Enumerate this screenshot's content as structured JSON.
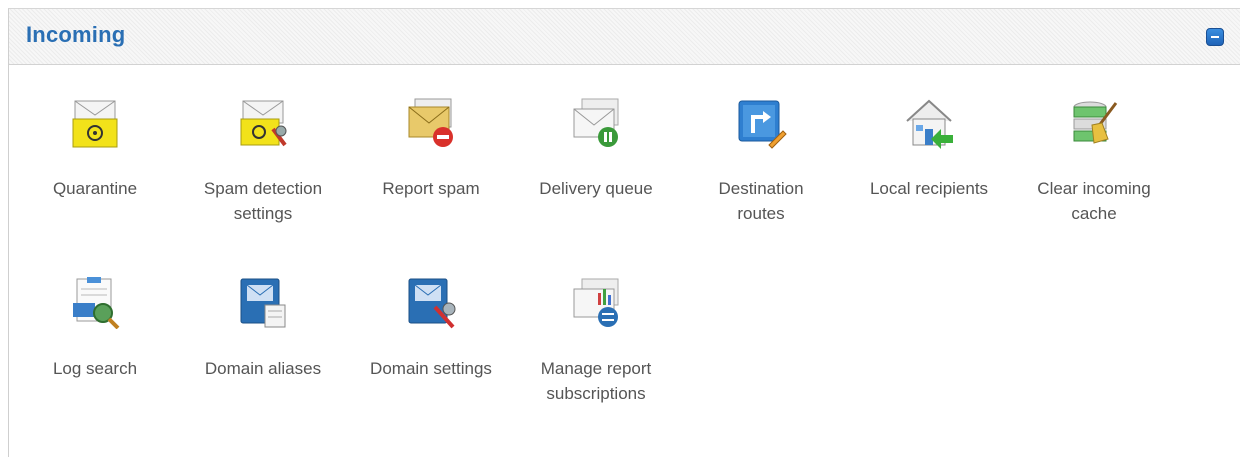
{
  "panel": {
    "title": "Incoming"
  },
  "items": [
    {
      "label": "Quarantine",
      "icon": "quarantine-icon"
    },
    {
      "label": "Spam detection settings",
      "icon": "spam-settings-icon"
    },
    {
      "label": "Report spam",
      "icon": "report-spam-icon"
    },
    {
      "label": "Delivery queue",
      "icon": "delivery-queue-icon"
    },
    {
      "label": "Destination routes",
      "icon": "destination-routes-icon"
    },
    {
      "label": "Local recipients",
      "icon": "local-recipients-icon"
    },
    {
      "label": "Clear incoming cache",
      "icon": "clear-cache-icon"
    },
    {
      "label": "Log search",
      "icon": "log-search-icon"
    },
    {
      "label": "Domain aliases",
      "icon": "domain-aliases-icon"
    },
    {
      "label": "Domain settings",
      "icon": "domain-settings-icon"
    },
    {
      "label": "Manage report subscriptions",
      "icon": "report-subscriptions-icon"
    }
  ]
}
